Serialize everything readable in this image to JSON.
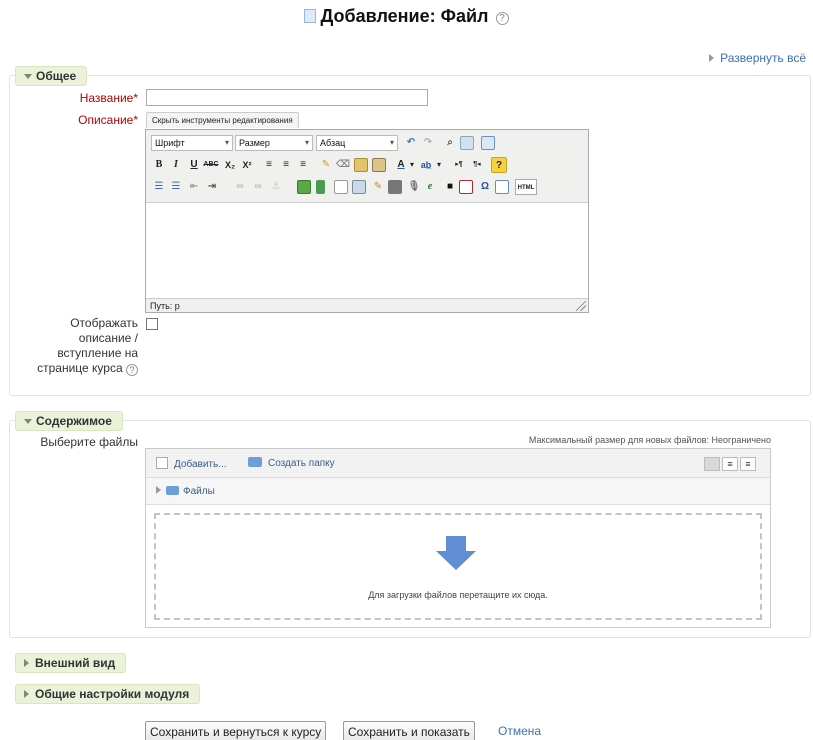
{
  "page": {
    "title": "Добавление: Файл",
    "help_glyph": "?"
  },
  "expand_all": "Развернуть всё",
  "general": {
    "legend": "Общее",
    "name_label": "Название",
    "required_mark": "*",
    "name_value": "",
    "description_label": "Описание",
    "hide_tools_label": "Скрыть инструменты редактирования",
    "font_select": "Шрифт",
    "size_select": "Размер",
    "paragraph_select": "Абзац",
    "toolbar_bold": "B",
    "toolbar_italic": "I",
    "toolbar_underline": "U",
    "toolbar_strike": "ABC",
    "toolbar_sub": "X₂",
    "toolbar_sup": "X²",
    "toolbar_help": "?",
    "toolbar_omega": "Ω",
    "toolbar_html": "HTML",
    "toolbar_text_color": "A",
    "toolbar_ltr": "▸¶",
    "toolbar_rtl": "¶◂",
    "status_path": "Путь: p",
    "show_description_label": "Отображать описание / вступление на странице курса",
    "show_description_lines": [
      "Отображать",
      "описание /",
      "вступление на",
      "странице курса"
    ],
    "show_description_checked": false
  },
  "content": {
    "legend": "Содержимое",
    "select_files_label": "Выберите файлы",
    "max_size_text": "Максимальный размер для новых файлов: Неограничено",
    "add_label": "Добавить...",
    "create_folder_label": "Создать папку",
    "path_root": "Файлы",
    "drop_hint": "Для загрузки файлов перетащите их сюда."
  },
  "appearance": {
    "legend": "Внешний вид"
  },
  "module_settings": {
    "legend": "Общие настройки модуля"
  },
  "actions": {
    "save_return": "Сохранить и вернуться к курсу",
    "save_show": "Сохранить и показать",
    "cancel": "Отмена"
  },
  "colors": {
    "legend_bg": "#eaf2d9",
    "required": "#b40000",
    "link": "#3d6fb0",
    "drop_arrow": "#5f8ed6"
  }
}
